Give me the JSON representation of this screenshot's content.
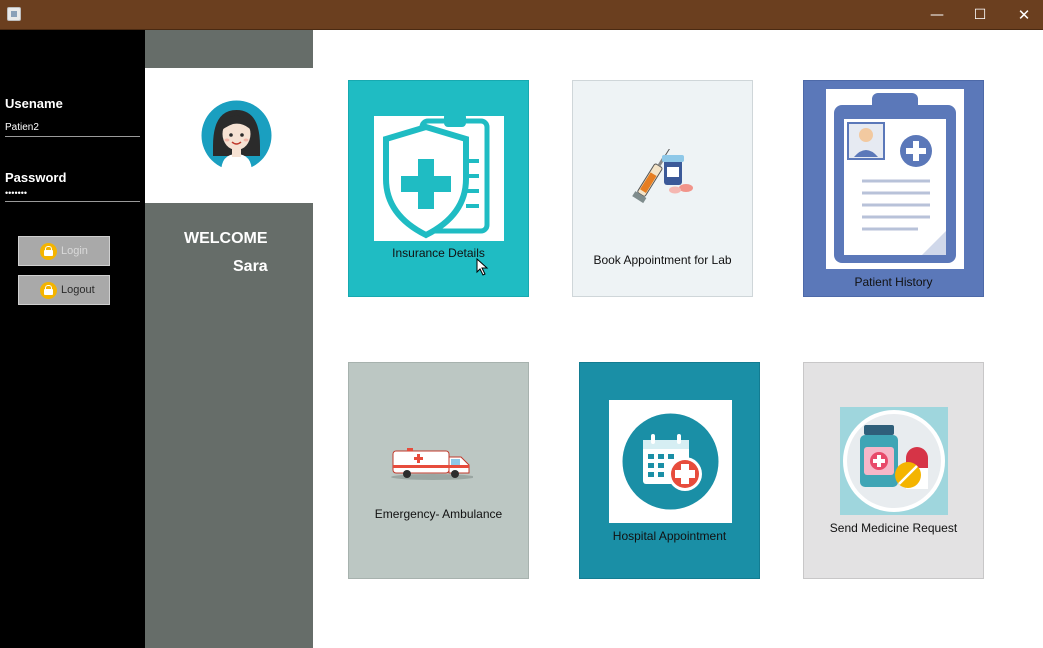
{
  "window": {
    "minimize_glyph": "—",
    "maximize_glyph": "☐",
    "close_glyph": "✕"
  },
  "login": {
    "username_label": "Usename",
    "username_value": "Patien2",
    "password_label": "Password",
    "password_value": "•••••••",
    "login_button": "Login",
    "logout_button": "Logout"
  },
  "profile": {
    "welcome": "WELCOME",
    "name": "Sara"
  },
  "tiles": [
    {
      "label": "Insurance Details",
      "icon": "insurance-shield-icon"
    },
    {
      "label": "Book Appointment for Lab",
      "icon": "syringe-pills-icon"
    },
    {
      "label": "Patient History",
      "icon": "clipboard-record-icon"
    },
    {
      "label": "Emergency- Ambulance",
      "icon": "ambulance-icon"
    },
    {
      "label": "Hospital Appointment",
      "icon": "calendar-cross-icon"
    },
    {
      "label": "Send Medicine Request",
      "icon": "medicine-bottle-icon"
    }
  ],
  "colors": {
    "titlebar": "#6b3f1f",
    "login_panel": "#000000",
    "profile_panel": "#666d69",
    "tile_insurance": "#1fbcc3",
    "tile_lab": "#eef3f5",
    "tile_history": "#5b78b9",
    "tile_ambulance": "#bcc7c3",
    "tile_hospital": "#1a8fa6",
    "tile_medicine": "#e3e2e3",
    "lock_icon": "#f4b400"
  }
}
